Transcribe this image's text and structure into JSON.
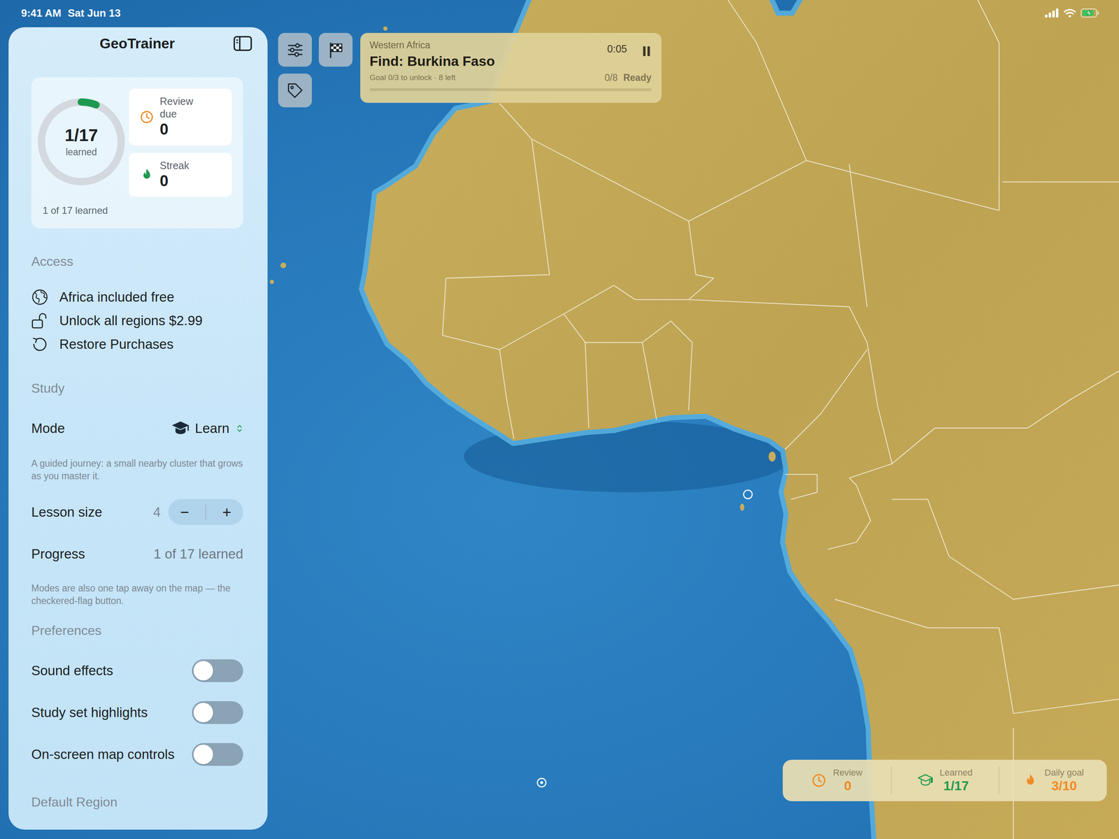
{
  "status_bar": {
    "time": "9:41 AM",
    "date": "Sat Jun 13",
    "battery_level": 0.85,
    "charging": true
  },
  "sidebar": {
    "title": "GeoTrainer",
    "summary": {
      "ring_value": "1/17",
      "ring_label": "learned",
      "level": 0.06,
      "review_label": "Review due",
      "review_value": "0",
      "streak_label": "Streak",
      "streak_value": "0",
      "footer": "1 of 17 learned"
    },
    "access": {
      "header": "Access",
      "items": [
        {
          "kind": "globe",
          "label": "Africa included free"
        },
        {
          "kind": "lock",
          "label": "Unlock all regions $2.99"
        },
        {
          "kind": "restore",
          "label": "Restore Purchases"
        }
      ]
    },
    "study": {
      "header": "Study",
      "mode_label": "Mode",
      "mode_value": "Learn",
      "mode_description": "A guided journey: a small nearby cluster that grows as you master it.",
      "lesson_label": "Lesson size",
      "lesson_value": "4",
      "minus": "−",
      "plus": "+",
      "progress_label": "Progress",
      "progress_value": "1 of 17 learned",
      "note": "Modes are also one tap away on the map — the checkered-flag button."
    },
    "preferences": {
      "header": "Preferences",
      "toggles": [
        {
          "label": "Sound effects",
          "on": false
        },
        {
          "label": "Study set highlights",
          "on": false
        },
        {
          "label": "On-screen map controls",
          "on": false
        }
      ]
    },
    "default_region": {
      "header": "Default Region"
    }
  },
  "prompt_card": {
    "region": "Western Africa",
    "prompt": "Find: Burkina Faso",
    "timer": "0:05",
    "goal": "Goal 0/3 to unlock · 8 left",
    "count": "0/8",
    "status": "Ready",
    "level": 0
  },
  "stats_bar": [
    {
      "kind": "review",
      "label": "Review",
      "value": "0",
      "color": "#f08a24"
    },
    {
      "kind": "learned",
      "label": "Learned",
      "value": "1/17",
      "color": "#1f9a4e"
    },
    {
      "kind": "daily",
      "label": "Daily goal",
      "value": "3/10",
      "color": "#f08a24"
    }
  ]
}
